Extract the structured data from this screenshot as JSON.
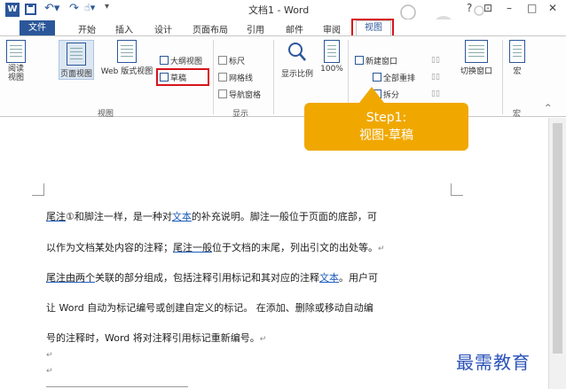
{
  "titlebar": {
    "app_icon_letter": "W",
    "title": "文档1 - Word",
    "help": "?",
    "restore": "⊡",
    "minimize": "–",
    "maximize": "□",
    "close": "✕"
  },
  "tabs": {
    "file": "文件",
    "home": "开始",
    "insert": "插入",
    "design": "设计",
    "layout": "页面布局",
    "references": "引用",
    "mailings": "邮件",
    "review": "审阅",
    "view": "视图"
  },
  "ribbon": {
    "views": {
      "read_mode": "阅读\n视图",
      "print_layout": "页面视图",
      "web_layout": "Web 版式视图",
      "outline": "大纲视图",
      "draft": "草稿",
      "group": "视图"
    },
    "show": {
      "ruler": "标尺",
      "gridlines": "网格线",
      "nav_pane": "导航窗格",
      "group": "显示"
    },
    "zoom": {
      "zoom": "显示比例",
      "hundred": "100%"
    },
    "window": {
      "new_window": "新建窗口",
      "arrange_all": "全部重排",
      "split": "拆分",
      "switch_windows": "切换窗口"
    },
    "macros": {
      "macros": "宏",
      "group": "宏"
    }
  },
  "callout": {
    "line1": "Step1:",
    "line2": "视图-草稿"
  },
  "document": {
    "p1_a": "尾注",
    "p1_b": "①和脚注一样，是一种对",
    "p1_c": "文本",
    "p1_d": "的补充说明。脚注一般位于页面的底部，可",
    "p2_a": "以作为文档某处内容的注释；",
    "p2_b": "尾注一般",
    "p2_c": "位于文档的末尾，列出引文的出处等。",
    "p3_a": "尾注由两个",
    "p3_b": "关联的部分组成，包括注释引用标记和其对应的注释",
    "p3_c": "文本",
    "p3_d": "。用户可",
    "p4": "让 Word 自动为标记编号或创建自定义的标记。 在添加、删除或移动自动编",
    "p5": "号的注释时，Word 将对注释引用标记重新编号。",
    "return_mark": "↵"
  },
  "watermark": "最需教育",
  "colors": {
    "accent": "#2b579a",
    "highlight_box": "#d6141c",
    "callout": "#f0a800",
    "link": "#1f5fbf",
    "watermark": "#2a52b8"
  }
}
